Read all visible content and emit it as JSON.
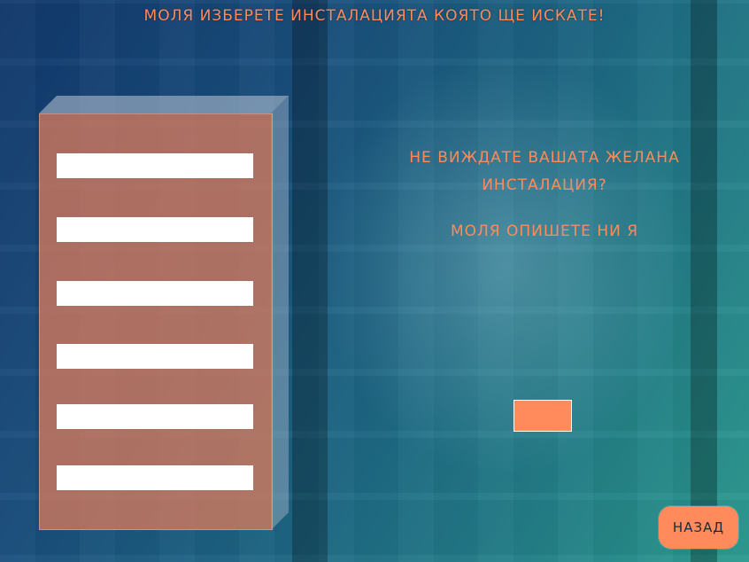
{
  "header": {
    "title": "МОЛЯ ИЗБЕРЕТЕ ИНСТАЛАЦИЯТА КОЯТО ЩЕ ИСКАТЕ!"
  },
  "options": [
    "",
    "",
    "",
    "",
    "",
    ""
  ],
  "side": {
    "question": "НЕ ВИЖДАТЕ ВАШАТА ЖЕЛАНА ИНСТАЛАЦИЯ?",
    "instruction": "МОЛЯ ОПИШЕТЕ НИ Я",
    "input_value": ""
  },
  "footer": {
    "back_label": "НАЗАД"
  },
  "colors": {
    "accent": "#ff8a5c",
    "panel": "#d67a5c",
    "bg_dark": "#123a6e",
    "bg_light": "#2a9a8e"
  }
}
